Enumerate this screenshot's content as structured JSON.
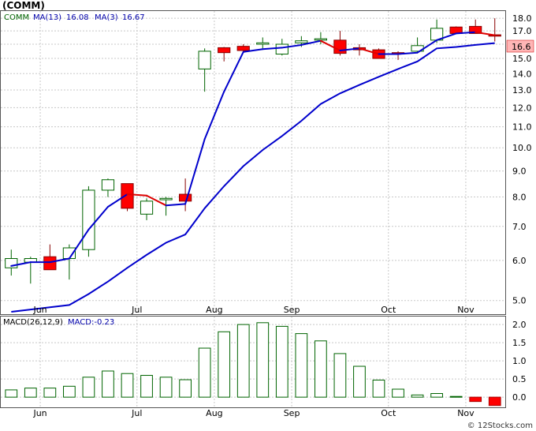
{
  "header": {
    "ticker": "(COMM)",
    "watermark": "© 12Stocks.com"
  },
  "price_legend": {
    "symbol": "COMM",
    "ma13_label": "MA(13)",
    "ma13_value": "16.08",
    "ma3_label": "MA(3)",
    "ma3_value": "16.67"
  },
  "last_price_tag": "16.6",
  "macd_legend": {
    "label": "MACD(26,12,9)",
    "value_label": "MACD:-0.23"
  },
  "colors": {
    "up_fill": "#ffffff",
    "up_stroke": "#006400",
    "down_fill": "#ff0000",
    "ma13": "#0000cc",
    "ma3": "#dd0000",
    "macd_bar": "#006400",
    "macd_neg": "#ff0000",
    "price_tag_bg": "#ffb6b6",
    "grid": "#c8c8c8",
    "legend_text": "#0000aa"
  },
  "chart_data": [
    {
      "type": "candlestick",
      "title": "(COMM)",
      "x_ticks": [
        {
          "i": 1.5,
          "label": "Jun"
        },
        {
          "i": 6.5,
          "label": "Jul"
        },
        {
          "i": 10.5,
          "label": "Aug"
        },
        {
          "i": 14.5,
          "label": "Sep"
        },
        {
          "i": 19.5,
          "label": "Oct"
        },
        {
          "i": 23.5,
          "label": "Nov"
        }
      ],
      "y_ticks": [
        5.0,
        6.0,
        7.0,
        8.0,
        9.0,
        10.0,
        11.0,
        12.0,
        13.0,
        14.0,
        15.0,
        16.0,
        17.0,
        18.0
      ],
      "y_scale": "log",
      "ylim": [
        4.7,
        18.6
      ],
      "candles": [
        {
          "o": 5.8,
          "h": 6.3,
          "l": 5.6,
          "c": 6.05
        },
        {
          "o": 5.95,
          "h": 6.1,
          "l": 5.4,
          "c": 6.05
        },
        {
          "o": 6.1,
          "h": 6.45,
          "l": 5.8,
          "c": 5.75
        },
        {
          "o": 6.05,
          "h": 6.45,
          "l": 5.5,
          "c": 6.35
        },
        {
          "o": 6.3,
          "h": 8.4,
          "l": 6.1,
          "c": 8.25
        },
        {
          "o": 8.25,
          "h": 8.7,
          "l": 8.0,
          "c": 8.65
        },
        {
          "o": 8.5,
          "h": 8.5,
          "l": 7.5,
          "c": 7.6
        },
        {
          "o": 7.4,
          "h": 7.95,
          "l": 7.2,
          "c": 7.85
        },
        {
          "o": 7.9,
          "h": 8.0,
          "l": 7.35,
          "c": 7.95
        },
        {
          "o": 8.1,
          "h": 8.7,
          "l": 7.5,
          "c": 7.85
        },
        {
          "o": 14.3,
          "h": 15.7,
          "l": 12.9,
          "c": 15.5
        },
        {
          "o": 15.75,
          "h": 15.8,
          "l": 14.8,
          "c": 15.4
        },
        {
          "o": 15.85,
          "h": 16.0,
          "l": 15.4,
          "c": 15.55
        },
        {
          "o": 16.0,
          "h": 16.5,
          "l": 15.7,
          "c": 16.1
        },
        {
          "o": 15.3,
          "h": 16.4,
          "l": 15.2,
          "c": 16.0
        },
        {
          "o": 16.1,
          "h": 16.6,
          "l": 15.8,
          "c": 16.25
        },
        {
          "o": 16.3,
          "h": 16.9,
          "l": 16.0,
          "c": 16.4
        },
        {
          "o": 16.3,
          "h": 17.0,
          "l": 15.2,
          "c": 15.35
        },
        {
          "o": 15.75,
          "h": 16.0,
          "l": 15.2,
          "c": 15.6
        },
        {
          "o": 15.6,
          "h": 15.7,
          "l": 15.0,
          "c": 15.0
        },
        {
          "o": 15.4,
          "h": 15.5,
          "l": 14.9,
          "c": 15.3
        },
        {
          "o": 15.5,
          "h": 16.5,
          "l": 15.4,
          "c": 15.9
        },
        {
          "o": 16.3,
          "h": 17.9,
          "l": 16.1,
          "c": 17.2
        },
        {
          "o": 17.3,
          "h": 17.35,
          "l": 16.8,
          "c": 16.8
        },
        {
          "o": 17.35,
          "h": 17.9,
          "l": 16.9,
          "c": 16.8
        },
        {
          "o": 16.7,
          "h": 18.0,
          "l": 16.2,
          "c": 16.6
        }
      ],
      "ma13": [
        4.75,
        4.8,
        4.85,
        4.9,
        5.15,
        5.45,
        5.8,
        6.15,
        6.5,
        6.75,
        7.6,
        8.4,
        9.2,
        9.9,
        10.55,
        11.3,
        12.2,
        12.8,
        13.3,
        13.8,
        14.3,
        14.8,
        15.7,
        15.8,
        15.95,
        16.08
      ],
      "ma3": [
        5.85,
        5.95,
        5.95,
        6.05,
        6.9,
        7.65,
        8.1,
        8.05,
        7.7,
        7.75,
        10.4,
        12.9,
        15.45,
        15.65,
        15.75,
        15.95,
        16.25,
        15.55,
        15.7,
        15.3,
        15.3,
        15.4,
        16.3,
        16.8,
        16.9,
        16.67
      ]
    },
    {
      "type": "bar",
      "title": "MACD(26,12,9)",
      "y_ticks": [
        0.0,
        0.5,
        1.0,
        1.5,
        2.0
      ],
      "ylim": [
        -0.28,
        2.22
      ],
      "values": [
        0.2,
        0.25,
        0.25,
        0.3,
        0.55,
        0.72,
        0.65,
        0.6,
        0.55,
        0.48,
        1.35,
        1.8,
        2.0,
        2.05,
        1.95,
        1.75,
        1.55,
        1.2,
        0.85,
        0.47,
        0.22,
        0.06,
        0.1,
        0.02,
        -0.12,
        -0.23
      ]
    }
  ]
}
